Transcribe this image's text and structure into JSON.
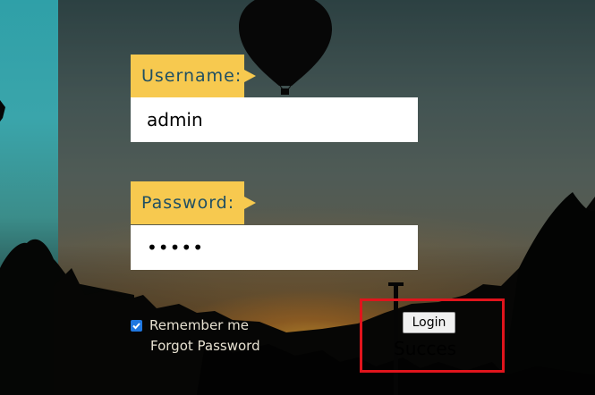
{
  "form": {
    "username_label": "Username:",
    "username_value": "admin",
    "password_label": "Password:",
    "password_value": "•••••",
    "remember_label": "Remember me",
    "remember_checked": true,
    "forgot_label": "Forgot Password",
    "login_label": "Login",
    "status_text": "Success"
  },
  "colors": {
    "label_bg": "#f7c94f",
    "label_text": "#1f4f63",
    "highlight": "#e0141c",
    "checkbox": "#1f77e0"
  }
}
